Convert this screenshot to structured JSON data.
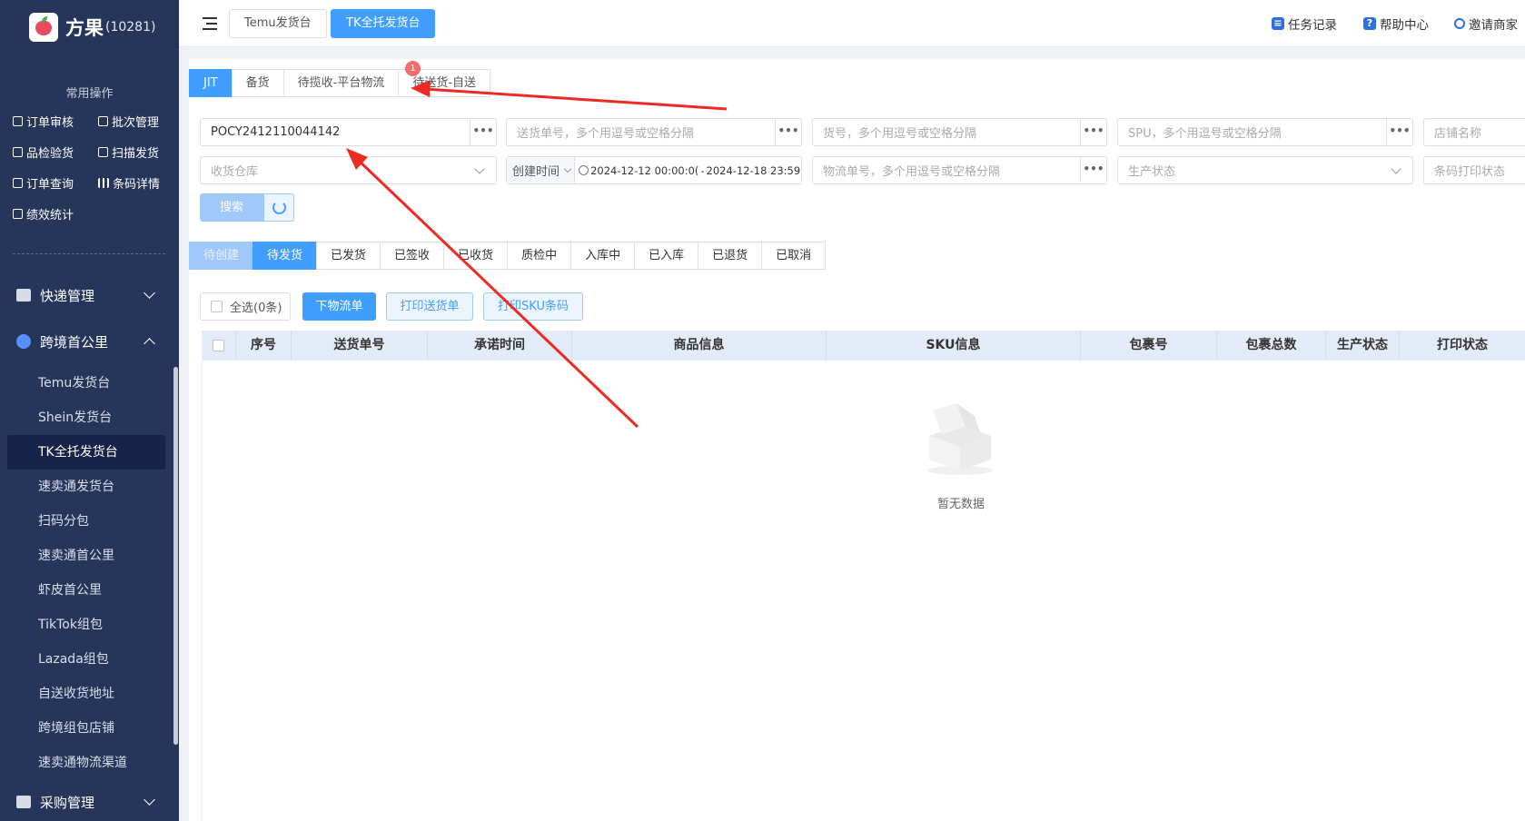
{
  "app": {
    "name": "方果",
    "account_id": "(10281)"
  },
  "sidebar": {
    "common_title": "常用操作",
    "quick_ops": [
      {
        "label": "订单审核",
        "icon": "audit-icon"
      },
      {
        "label": "批次管理",
        "icon": "batch-icon"
      },
      {
        "label": "品检验货",
        "icon": "inspect-icon"
      },
      {
        "label": "扫描发货",
        "icon": "scan-icon"
      },
      {
        "label": "订单查询",
        "icon": "order-search-icon"
      },
      {
        "label": "条码详情",
        "icon": "barcode-icon"
      },
      {
        "label": "绩效统计",
        "icon": "stats-icon"
      }
    ],
    "groups": [
      {
        "label": "快递管理",
        "icon": "calendar-icon",
        "expanded": false
      },
      {
        "label": "跨境首公里",
        "icon": "globe-icon",
        "expanded": true
      },
      {
        "label": "采购管理",
        "icon": "store-icon",
        "expanded": false
      }
    ],
    "submenu": [
      {
        "label": "Temu发货台",
        "active": false
      },
      {
        "label": "Shein发货台",
        "active": false
      },
      {
        "label": "TK全托发货台",
        "active": true
      },
      {
        "label": "速卖通发货台",
        "active": false
      },
      {
        "label": "扫码分包",
        "active": false
      },
      {
        "label": "速卖通首公里",
        "active": false
      },
      {
        "label": "虾皮首公里",
        "active": false
      },
      {
        "label": "TikTok组包",
        "active": false
      },
      {
        "label": "Lazada组包",
        "active": false
      },
      {
        "label": "自送收货地址",
        "active": false
      },
      {
        "label": "跨境组包店铺",
        "active": false
      },
      {
        "label": "速卖通物流渠道",
        "active": false
      }
    ]
  },
  "topbar": {
    "tabs": [
      {
        "label": "Temu发货台",
        "active": false
      },
      {
        "label": "TK全托发货台",
        "active": true
      }
    ],
    "task_log": "任务记录",
    "help_center": "帮助中心",
    "invite": "邀请商家"
  },
  "sub_tabs": [
    {
      "label": "JIT",
      "active": true
    },
    {
      "label": "备货",
      "active": false
    },
    {
      "label": "待揽收-平台物流",
      "active": false
    },
    {
      "label": "待送货-自送",
      "active": false
    }
  ],
  "notification_count": "1",
  "filters": {
    "order_no": {
      "value": "POCY2412110044142"
    },
    "delivery_no": {
      "placeholder": "送货单号，多个用逗号或空格分隔"
    },
    "item_no": {
      "placeholder": "货号，多个用逗号或空格分隔"
    },
    "spu": {
      "placeholder": "SPU，多个用逗号或空格分隔"
    },
    "shop": {
      "placeholder": "店铺名称"
    },
    "warehouse": {
      "placeholder": "收货仓库"
    },
    "date_type": "创建时间",
    "date_start": "2024-12-12 00:00:0(",
    "date_sep": "-",
    "date_end": "2024-12-18 23:59:59",
    "logistics_no": {
      "placeholder": "物流单号，多个用逗号或空格分隔"
    },
    "production_status": {
      "placeholder": "生产状态"
    },
    "barcode_print_status": {
      "placeholder": "条码打印状态"
    },
    "more_symbol": "•••"
  },
  "search_button": "搜索",
  "status_tabs": [
    {
      "label": "待创建",
      "state": "disabled"
    },
    {
      "label": "待发货",
      "state": "active"
    },
    {
      "label": "已发货",
      "state": "normal"
    },
    {
      "label": "已签收",
      "state": "normal"
    },
    {
      "label": "已收货",
      "state": "normal"
    },
    {
      "label": "质检中",
      "state": "normal"
    },
    {
      "label": "入库中",
      "state": "normal"
    },
    {
      "label": "已入库",
      "state": "normal"
    },
    {
      "label": "已退货",
      "state": "normal"
    },
    {
      "label": "已取消",
      "state": "normal"
    }
  ],
  "actions": {
    "select_all": "全选(0条)",
    "create_logistics": "下物流单",
    "print_delivery": "打印送货单",
    "print_sku": "打印SKU条码"
  },
  "table": {
    "columns": [
      "序号",
      "送货单号",
      "承诺时间",
      "商品信息",
      "SKU信息",
      "包裹号",
      "包裹总数",
      "生产状态",
      "打印状态"
    ],
    "rows": [],
    "empty_text": "暂无数据"
  },
  "colors": {
    "primary": "#409eff",
    "sidebar_bg": "#25365a",
    "annotation_arrow": "#ee2a24"
  }
}
